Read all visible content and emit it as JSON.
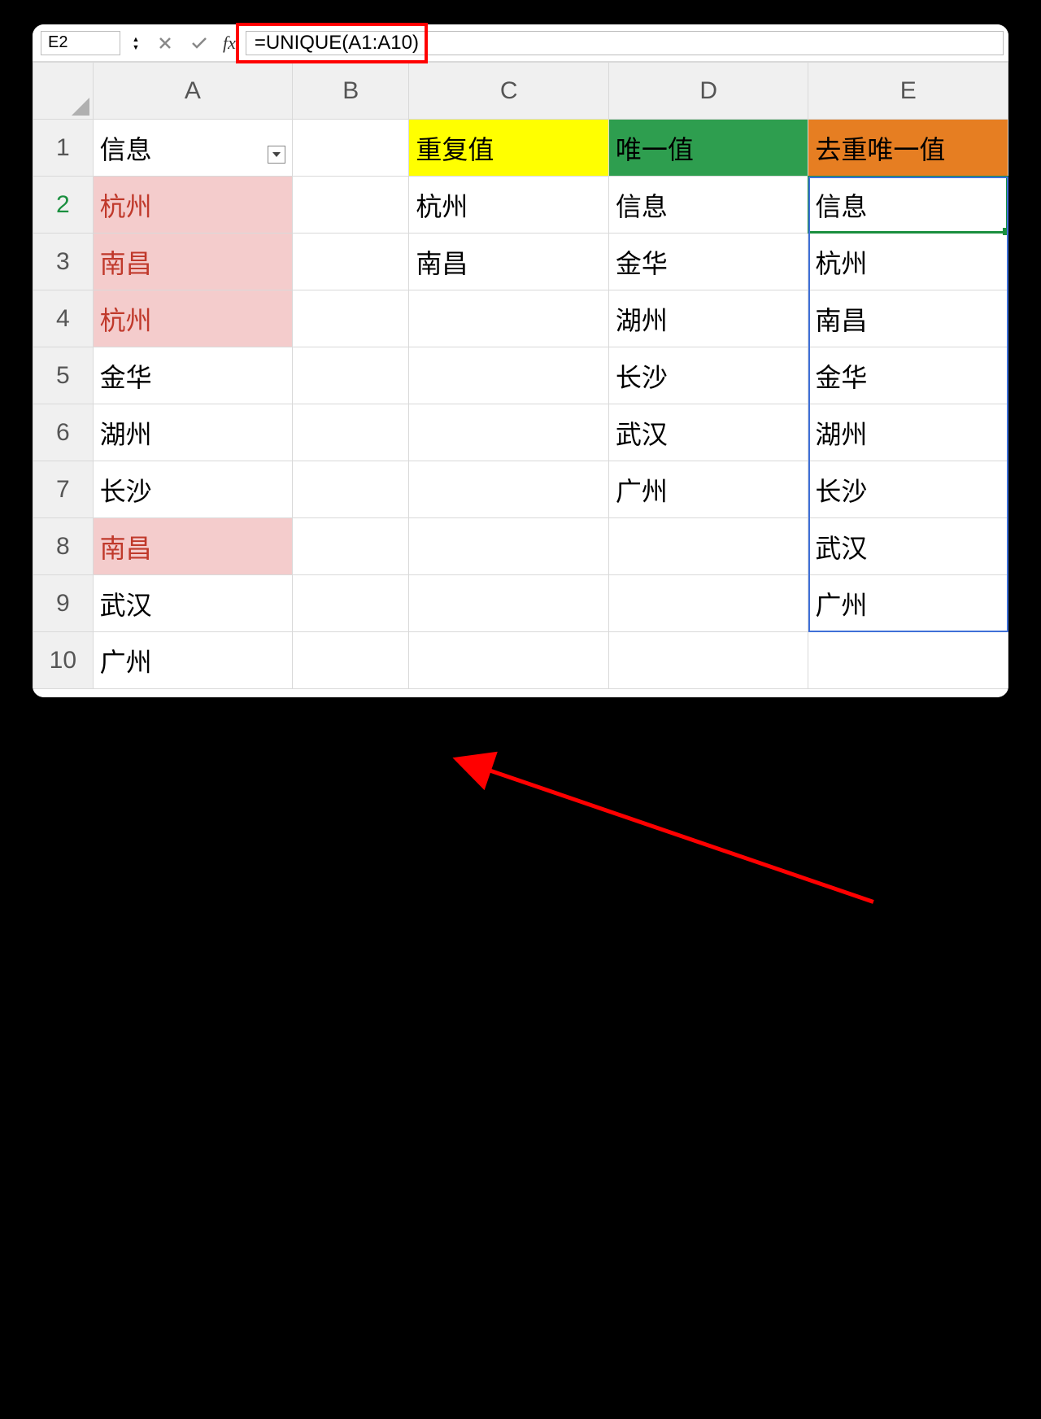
{
  "nameBox": "E2",
  "formula": "=UNIQUE(A1:A10)",
  "columns": [
    "A",
    "B",
    "C",
    "D",
    "E"
  ],
  "rows": [
    "1",
    "2",
    "3",
    "4",
    "5",
    "6",
    "7",
    "8",
    "9",
    "10"
  ],
  "activeRow": "2",
  "cells": {
    "A1": {
      "v": "信息",
      "filter": true
    },
    "A2": {
      "v": "杭州",
      "cls": "pink-cell"
    },
    "A3": {
      "v": "南昌",
      "cls": "pink-cell"
    },
    "A4": {
      "v": "杭州",
      "cls": "pink-cell"
    },
    "A5": {
      "v": "金华"
    },
    "A6": {
      "v": "湖州"
    },
    "A7": {
      "v": "长沙"
    },
    "A8": {
      "v": "南昌",
      "cls": "pink-cell"
    },
    "A9": {
      "v": "武汉"
    },
    "A10": {
      "v": "广州"
    },
    "C1": {
      "v": "重复值",
      "cls": "yellow-hdr"
    },
    "C2": {
      "v": "杭州"
    },
    "C3": {
      "v": "南昌"
    },
    "D1": {
      "v": "唯一值",
      "cls": "green-hdr"
    },
    "D2": {
      "v": "信息"
    },
    "D3": {
      "v": "金华"
    },
    "D4": {
      "v": "湖州"
    },
    "D5": {
      "v": "长沙"
    },
    "D6": {
      "v": "武汉"
    },
    "D7": {
      "v": "广州"
    },
    "E1": {
      "v": "去重唯一值",
      "cls": "orange-hdr"
    },
    "E2": {
      "v": "信息"
    },
    "E3": {
      "v": "杭州"
    },
    "E4": {
      "v": "南昌"
    },
    "E5": {
      "v": "金华"
    },
    "E6": {
      "v": "湖州"
    },
    "E7": {
      "v": "长沙"
    },
    "E8": {
      "v": "武汉"
    },
    "E9": {
      "v": "广州"
    }
  },
  "selection": {
    "col": "E",
    "row": 2
  },
  "spillRange": {
    "col": "E",
    "startRow": 2,
    "endRow": 9
  }
}
